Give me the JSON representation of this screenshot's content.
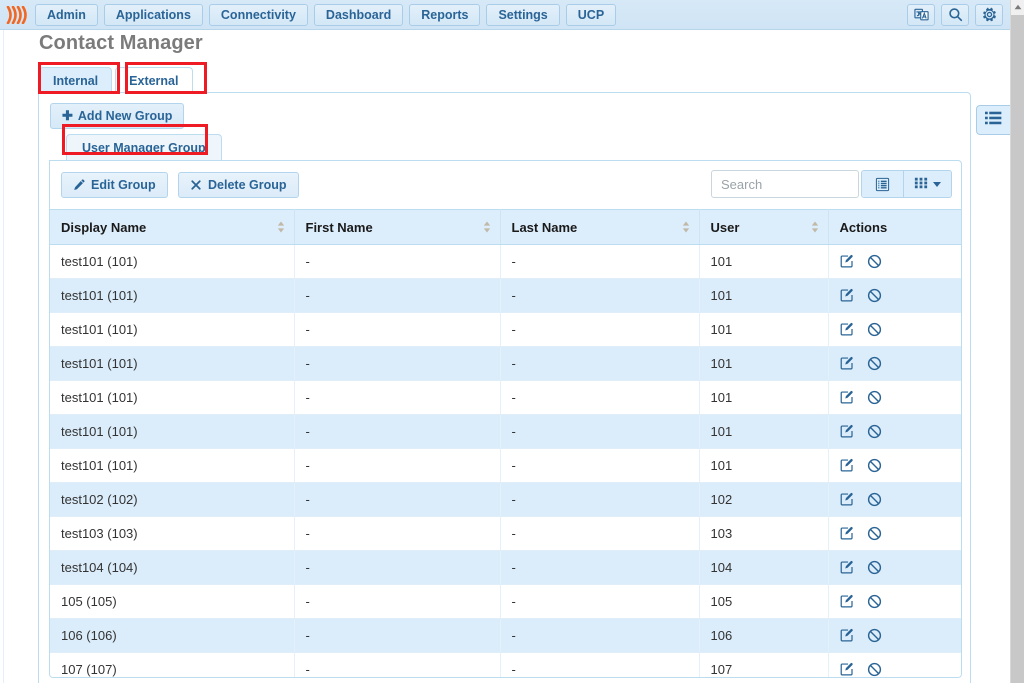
{
  "topnav": {
    "brand_icon": "freepbx-logo-icon",
    "items": [
      {
        "label": "Admin",
        "name": "nav-admin"
      },
      {
        "label": "Applications",
        "name": "nav-applications"
      },
      {
        "label": "Connectivity",
        "name": "nav-connectivity"
      },
      {
        "label": "Dashboard",
        "name": "nav-dashboard"
      },
      {
        "label": "Reports",
        "name": "nav-reports"
      },
      {
        "label": "Settings",
        "name": "nav-settings"
      },
      {
        "label": "UCP",
        "name": "nav-ucp"
      }
    ],
    "icons": [
      {
        "name": "language-icon",
        "title": "Language"
      },
      {
        "name": "search-icon",
        "title": "Search"
      },
      {
        "name": "gear-icon",
        "title": "Settings"
      }
    ]
  },
  "page": {
    "title": "Contact Manager"
  },
  "tabs": [
    {
      "label": "Internal",
      "active": true,
      "highlighted": true
    },
    {
      "label": "External",
      "active": false,
      "highlighted": true
    }
  ],
  "panel": {
    "add_group_label": "Add New Group",
    "add_group_icon": "plus-icon",
    "group_tab_label": "User Manager Group",
    "group_tab_highlighted": true
  },
  "toolbar": {
    "edit_group_label": "Edit Group",
    "edit_group_icon": "pencil-icon",
    "delete_group_label": "Delete Group",
    "delete_group_icon": "times-icon",
    "search_placeholder": "Search",
    "search_value": "",
    "list_view_icon": "list-view-icon",
    "column_chooser_icon": "grid-columns-icon"
  },
  "side_button": {
    "icon": "list-menu-icon"
  },
  "table": {
    "columns": [
      {
        "label": "Display Name",
        "sortable": true
      },
      {
        "label": "First Name",
        "sortable": true
      },
      {
        "label": "Last Name",
        "sortable": true
      },
      {
        "label": "User",
        "sortable": true
      },
      {
        "label": "Actions",
        "sortable": false
      }
    ],
    "row_action_icons": [
      "edit-icon",
      "ban-icon"
    ],
    "rows": [
      {
        "display_name": "test101 (101)",
        "first_name": "-",
        "last_name": "-",
        "user": "101"
      },
      {
        "display_name": "test101 (101)",
        "first_name": "-",
        "last_name": "-",
        "user": "101"
      },
      {
        "display_name": "test101 (101)",
        "first_name": "-",
        "last_name": "-",
        "user": "101"
      },
      {
        "display_name": "test101 (101)",
        "first_name": "-",
        "last_name": "-",
        "user": "101"
      },
      {
        "display_name": "test101 (101)",
        "first_name": "-",
        "last_name": "-",
        "user": "101"
      },
      {
        "display_name": "test101 (101)",
        "first_name": "-",
        "last_name": "-",
        "user": "101"
      },
      {
        "display_name": "test101 (101)",
        "first_name": "-",
        "last_name": "-",
        "user": "101"
      },
      {
        "display_name": "test102 (102)",
        "first_name": "-",
        "last_name": "-",
        "user": "102"
      },
      {
        "display_name": "test103 (103)",
        "first_name": "-",
        "last_name": "-",
        "user": "103"
      },
      {
        "display_name": "test104 (104)",
        "first_name": "-",
        "last_name": "-",
        "user": "104"
      },
      {
        "display_name": "105 (105)",
        "first_name": "-",
        "last_name": "-",
        "user": "105"
      },
      {
        "display_name": "106 (106)",
        "first_name": "-",
        "last_name": "-",
        "user": "106"
      },
      {
        "display_name": "107 (107)",
        "first_name": "-",
        "last_name": "-",
        "user": "107"
      }
    ]
  },
  "scrollbar": {
    "up_arrow_icon": "scroll-up-icon"
  },
  "colors": {
    "accent": "#2a6496",
    "nav_bg": "#d7e9f7",
    "row_stripe": "#dbecfa",
    "header_bg": "#dceefb",
    "highlight": "#ee1b24",
    "brand_orange": "#f26722"
  }
}
